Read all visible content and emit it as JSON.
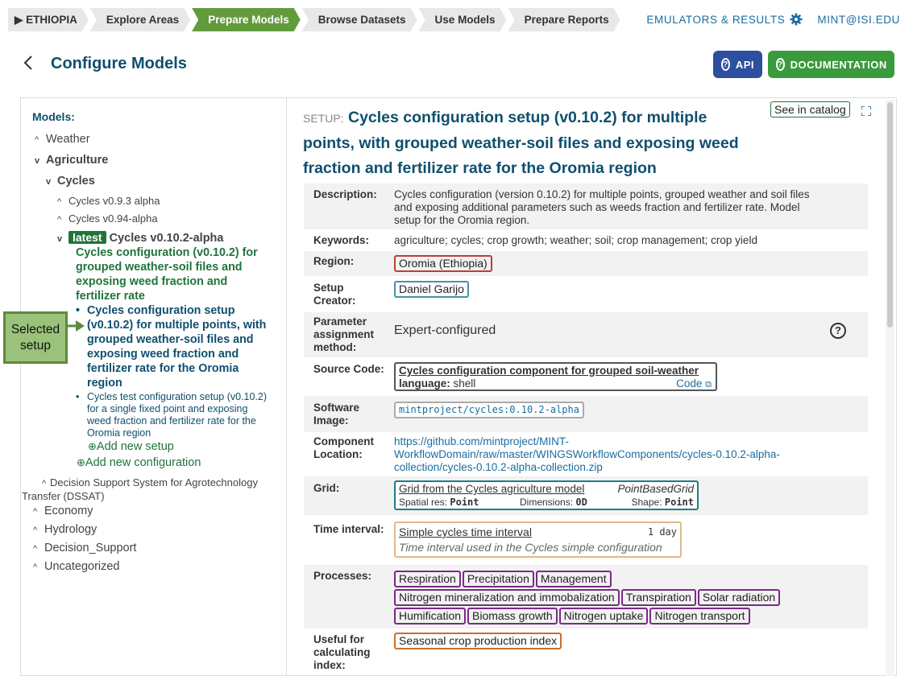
{
  "nav": {
    "crumbs": [
      "▶ ETHIOPIA",
      "Explore Areas",
      "Prepare Models",
      "Browse Datasets",
      "Use Models",
      "Prepare Reports"
    ],
    "emulators": "EMULATORS & RESULTS",
    "user": "MINT@ISI.EDU"
  },
  "header": {
    "title": "Configure Models",
    "api": "API",
    "docs": "DOCUMENTATION"
  },
  "tree": {
    "heading": "Models:",
    "weather": "Weather",
    "agriculture": "Agriculture",
    "cycles": "Cycles",
    "v093": "Cycles v0.9.3 alpha",
    "v094": "Cycles v0.94-alpha",
    "latest_badge": "latest",
    "v0102": "Cycles v0.10.2-alpha",
    "config": [
      "Cycles configuration (v0.10.2) for",
      "grouped weather-soil files and",
      "exposing weed fraction and",
      "fertilizer rate"
    ],
    "setup1": [
      "Cycles configuration setup",
      "(v0.10.2) for multiple points, with",
      "grouped weather-soil files and",
      "exposing weed fraction and",
      "fertilizer rate for the Oromia",
      "region"
    ],
    "setup2": [
      "Cycles test configuration setup (v0.10.2)",
      "for a single fixed point and exposing",
      "weed fraction and fertilizer rate for the",
      "Oromia region"
    ],
    "add_setup": "Add new setup",
    "add_config": "Add new configuration",
    "dssat": [
      "Decision Support System for Agrotechnology",
      "Transfer (DSSAT)"
    ],
    "economy": "Economy",
    "hydrology": "Hydrology",
    "decision": "Decision_Support",
    "uncategorized": "Uncategorized"
  },
  "callout": [
    "Selected",
    "setup"
  ],
  "setup": {
    "label": "SETUP:",
    "title_lines": [
      " Cycles configuration setup (v0.10.2) for multiple",
      "points, with grouped weather-soil files and exposing weed",
      "fraction and fertilizer rate for the Oromia region"
    ],
    "see_catalog": "See in catalog",
    "description_label": "Description:",
    "description": [
      "Cycles configuration (version 0.10.2) for multiple points, grouped weather and soil files",
      "and exposing additional parameters such as weeds fraction and fertilizer rate. Model",
      "setup for the Oromia region."
    ],
    "keywords_label": "Keywords:",
    "keywords": "agriculture; cycles; crop growth; weather; soil; crop management; crop yield",
    "region_label": "Region:",
    "region": "Oromia (Ethiopia)",
    "creator_label": [
      "Setup",
      "Creator:"
    ],
    "creator": "Daniel Garijo",
    "param_label": [
      "Parameter",
      "assignment",
      "method:"
    ],
    "param": "Expert-configured",
    "source_label": "Source Code:",
    "source_title": "Cycles configuration component for grouped soil-weather",
    "source_lang_label": "language:",
    "source_lang": "shell",
    "source_code": "Code",
    "image_label": [
      "Software",
      "Image:"
    ],
    "image": "mintproject/cycles:0.10.2-alpha",
    "location_label": [
      "Component",
      "Location:"
    ],
    "location": [
      "https://github.com/mintproject/MINT-",
      "WorkflowDomain/raw/master/WINGSWorkflowComponents/cycles-0.10.2-alpha-",
      "collection/cycles-0.10.2-alpha-collection.zip"
    ],
    "grid_label": "Grid:",
    "grid_name": "Grid from the Cycles agriculture model",
    "grid_type": "PointBasedGrid",
    "grid_res_label": "Spatial res:",
    "grid_res": "Point",
    "grid_dim_label": "Dimensions:",
    "grid_dim": "0D",
    "grid_shape_label": "Shape:",
    "grid_shape": "Point",
    "time_label": "Time interval:",
    "time_name": "Simple cycles time interval",
    "time_value": "1 day",
    "time_desc": "Time interval used in the Cycles simple configuration",
    "processes_label": "Processes:",
    "processes": [
      "Respiration",
      "Precipitation",
      "Management",
      "Nitrogen mineralization and immobalization",
      "Transpiration",
      "Solar radiation",
      "Humification",
      "Biomass growth",
      "Nitrogen uptake",
      "Nitrogen transport"
    ],
    "index_label": [
      "Useful for",
      "calculating",
      "index:"
    ],
    "index": "Seasonal crop production index"
  },
  "colors": {
    "green": "#629b3c",
    "dark_green": "#21733b",
    "navy": "#0f4f6e",
    "api_blue": "#2c4fa0",
    "region_red": "#b5413a",
    "creator_teal": "#4d8fa8",
    "process_purple": "#7a2a86",
    "index_orange": "#c8702a",
    "time_tan": "#e0b98a"
  }
}
